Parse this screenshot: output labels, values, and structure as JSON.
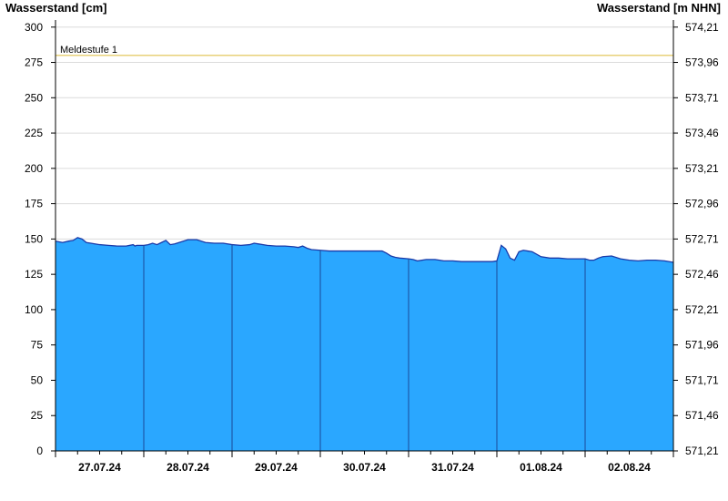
{
  "chart_data": {
    "type": "area",
    "ylabel_left": "Wasserstand [cm]",
    "ylabel_right": "Wasserstand [m NHN]",
    "ylim": [
      0,
      305
    ],
    "left_ticks": [
      0,
      25,
      50,
      75,
      100,
      125,
      150,
      175,
      200,
      225,
      250,
      275,
      300
    ],
    "right_ticks": [
      "571,21",
      "571,46",
      "571,71",
      "571,96",
      "572,21",
      "572,46",
      "572,71",
      "572,96",
      "573,21",
      "573,46",
      "573,71",
      "573,96",
      "574,21"
    ],
    "x_range_days": [
      0,
      7
    ],
    "day_labels": [
      "27.07.24",
      "28.07.24",
      "29.07.24",
      "30.07.24",
      "31.07.24",
      "01.08.24",
      "02.08.24"
    ],
    "grid": true,
    "reference_line": {
      "label": "Meldestufe 1",
      "value": 280,
      "color": "#e8d27a"
    },
    "fill_color": "#2aa7ff",
    "line_color": "#1a3aa8",
    "series": [
      {
        "x": [
          0,
          0.08,
          0.15,
          0.2,
          0.25,
          0.3,
          0.35,
          0.4,
          0.5,
          0.6,
          0.7,
          0.8,
          0.88,
          0.9,
          0.92,
          1.0,
          1.05,
          1.1,
          1.15,
          1.2,
          1.25,
          1.3,
          1.35,
          1.4,
          1.5,
          1.6,
          1.7,
          1.8,
          1.9,
          2.0,
          2.1,
          2.2,
          2.25,
          2.3,
          2.4,
          2.5,
          2.6,
          2.7,
          2.75,
          2.8,
          2.85,
          2.9,
          3.0,
          3.1,
          3.2,
          3.3,
          3.4,
          3.5,
          3.6,
          3.7,
          3.75,
          3.8,
          3.85,
          3.9,
          4.0,
          4.05,
          4.1,
          4.2,
          4.3,
          4.4,
          4.5,
          4.6,
          4.7,
          4.8,
          4.9,
          4.95,
          5.0,
          5.05,
          5.1,
          5.15,
          5.2,
          5.25,
          5.3,
          5.35,
          5.4,
          5.5,
          5.6,
          5.7,
          5.8,
          5.9,
          6.0,
          6.05,
          6.1,
          6.15,
          6.2,
          6.3,
          6.4,
          6.5,
          6.6,
          6.7,
          6.8,
          6.9,
          7.0
        ],
        "y": [
          148.5,
          147.5,
          148.5,
          149,
          151,
          150,
          147.5,
          147,
          146,
          145.5,
          145,
          145,
          146,
          145,
          145.5,
          145.5,
          146,
          147,
          146,
          147.5,
          149,
          146,
          146.5,
          147.5,
          149.5,
          149.5,
          147.5,
          147,
          147,
          146,
          145.5,
          146,
          147,
          146.5,
          145.5,
          145,
          145,
          144.5,
          144,
          145,
          143.5,
          142.5,
          142,
          141.5,
          141.5,
          141.5,
          141.5,
          141.5,
          141.5,
          141.5,
          140,
          138,
          137,
          136.5,
          136,
          135.5,
          134.5,
          135.5,
          135.5,
          134.5,
          134.5,
          134,
          134,
          134,
          134,
          134,
          134.5,
          145.5,
          143,
          136.5,
          135,
          141,
          142,
          141.5,
          141,
          137.5,
          136.5,
          136.5,
          136,
          136,
          136,
          135,
          135,
          136.5,
          137.5,
          138,
          136,
          135,
          134.5,
          135,
          135,
          134.5,
          133.5
        ]
      }
    ]
  }
}
